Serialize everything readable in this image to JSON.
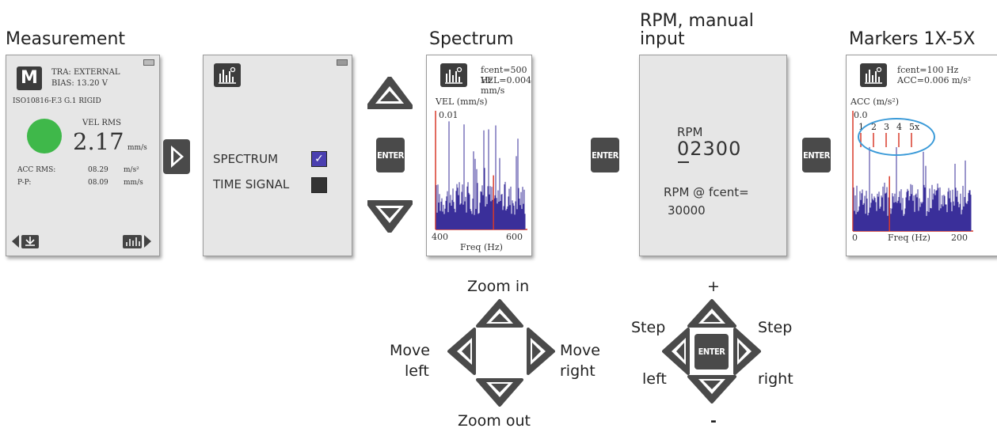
{
  "headings": {
    "measurement": "Measurement",
    "spectrum": "Spectrum",
    "rpm_line1": "RPM, manual",
    "rpm_line2": "input",
    "markers": "Markers 1X-5X"
  },
  "measurement_screen": {
    "mode_letter": "M",
    "tra": "TRA: EXTERNAL",
    "bias": "BIAS: 13.20 V",
    "iso": "ISO10816-F.3 G.1 RIGID",
    "vel_label": "VEL RMS",
    "vel_value": "2.17",
    "vel_unit": "mm/s",
    "acc_label": "ACC RMS:",
    "acc_value": "08.29",
    "acc_unit": "m/s²",
    "pp_label": "P-P:",
    "pp_value": "08.09",
    "pp_unit": "mm/s",
    "status_color": "#3fb84a"
  },
  "menu_screen": {
    "option1": "SPECTRUM",
    "option2": "TIME SIGNAL",
    "option1_check": "✓"
  },
  "spectrum_screen": {
    "fcent": "fcent=500 Hz",
    "vel": "VEL=0.004 mm/s",
    "ylabel": "VEL (mm/s)",
    "ymax": "0.01",
    "xmin": "400",
    "xmax": "600",
    "xlabel": "Freq (Hz)"
  },
  "rpm_screen": {
    "rpm_label": "RPM",
    "rpm_value": "02300",
    "rpm_fcent_label": "RPM @ fcent=",
    "rpm_fcent_value": "30000"
  },
  "markers_screen": {
    "fcent": "fcent=100 Hz",
    "acc": "ACC=0.006 m/s²",
    "ylabel": "ACC (m/s²)",
    "ymax": "0.0",
    "markers": [
      "1",
      "2",
      "3",
      "4",
      "5x"
    ],
    "xmin": "0",
    "xmax": "200",
    "xlabel": "Freq (Hz)"
  },
  "buttons": {
    "enter": "ENTER"
  },
  "zoom_pad": {
    "up": "Zoom in",
    "down": "Zoom out",
    "left_1": "Move",
    "left_2": "left",
    "right_1": "Move",
    "right_2": "right"
  },
  "step_pad": {
    "up": "+",
    "down": "-",
    "left_1": "Step",
    "left_2": "left",
    "right_1": "Step",
    "right_2": "right"
  },
  "colors": {
    "bars": "#3a2f9a",
    "axis": "#d83a2a",
    "circle": "#3a9ad8",
    "button": "#4a4a4a"
  }
}
